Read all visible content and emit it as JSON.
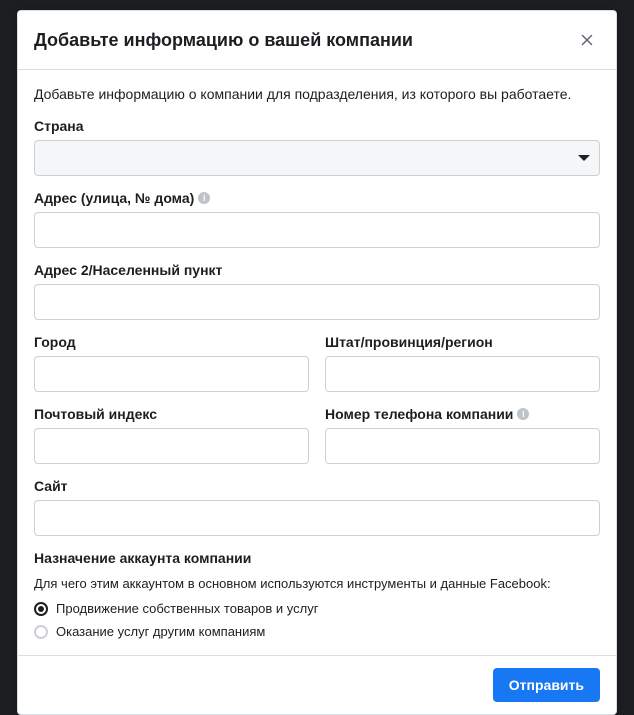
{
  "title": "Добавьте информацию о вашей компании",
  "description": "Добавьте информацию о компании для подразделения, из которого вы работаете.",
  "fields": {
    "country": {
      "label": "Страна",
      "value": ""
    },
    "address1": {
      "label": "Адрес (улица, № дома)",
      "value": "",
      "hasInfo": true
    },
    "address2": {
      "label": "Адрес 2/Населенный пункт",
      "value": ""
    },
    "city": {
      "label": "Город",
      "value": ""
    },
    "state": {
      "label": "Штат/провинция/регион",
      "value": ""
    },
    "postal": {
      "label": "Почтовый индекс",
      "value": ""
    },
    "phone": {
      "label": "Номер телефона компании",
      "value": "",
      "hasInfo": true
    },
    "website": {
      "label": "Сайт",
      "value": ""
    }
  },
  "purpose": {
    "heading": "Назначение аккаунта компании",
    "question": "Для чего этим аккаунтом в основном используются инструменты и данные Facebook:",
    "options": [
      {
        "label": "Продвижение собственных товаров и услуг",
        "selected": true
      },
      {
        "label": "Оказание услуг другим компаниям",
        "selected": false
      }
    ]
  },
  "submit": "Отправить",
  "infoGlyph": "i"
}
